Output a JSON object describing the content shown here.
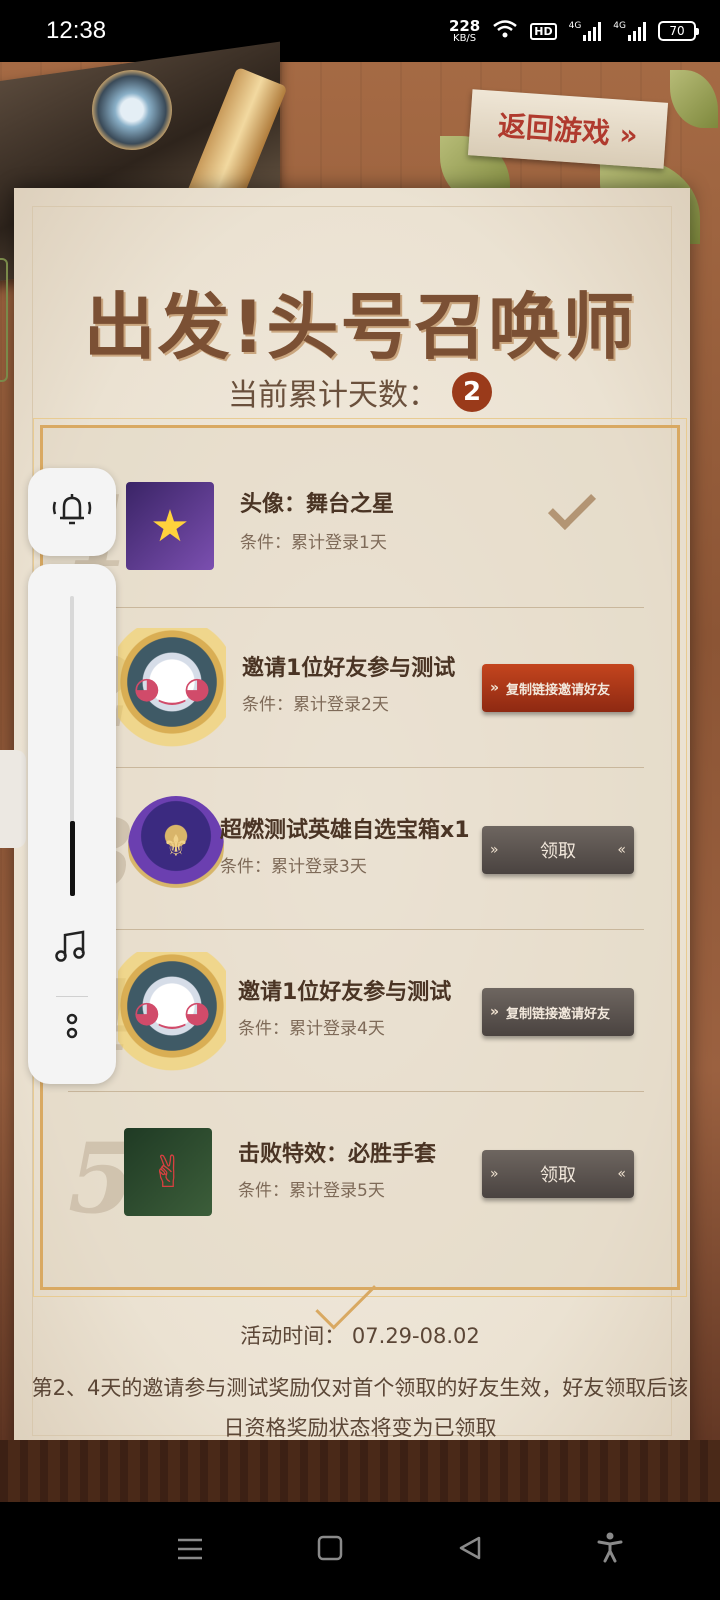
{
  "status_bar": {
    "time": "12:38",
    "net_speed_value": "228",
    "net_speed_unit": "KB/S",
    "wifi_icon": "wifi-icon",
    "hd_badge": "HD",
    "signal1_label": "4G",
    "signal2_label": "4G",
    "battery": "70"
  },
  "header": {
    "return_button": "返回游戏 »",
    "title": "出发!头号召唤师",
    "days_label": "当前累计天数：",
    "days_value": "2"
  },
  "rewards": [
    {
      "index": "1",
      "icon": "star-avatar-icon",
      "title": "头像：舞台之星",
      "condition": "条件：累计登录1天",
      "status": "claimed"
    },
    {
      "index": "2",
      "icon": "poro-icon",
      "title": "邀请1位好友参与测试",
      "condition": "条件：累计登录2天",
      "button": "复制链接邀请好友",
      "button_color": "#c4451e"
    },
    {
      "index": "3",
      "icon": "hero-chest-icon",
      "title": "超燃测试英雄自选宝箱x1",
      "condition": "条件：累计登录3天",
      "button": "领取",
      "button_color": "#5c5450"
    },
    {
      "index": "4",
      "icon": "poro-icon",
      "title": "邀请1位好友参与测试",
      "condition": "条件：累计登录4天",
      "button": "复制链接邀请好友",
      "button_color": "#5c5450"
    },
    {
      "index": "5",
      "icon": "victory-glove-icon",
      "title": "击败特效：必胜手套",
      "condition": "条件：累计登录5天",
      "button": "领取",
      "button_color": "#5c5450"
    }
  ],
  "footer": {
    "activity_time": "活动时间：  07.29-08.02",
    "note": "第2、4天的邀请参与测试奖励仅对首个领取的好友生效，好友领取后该日资格奖励状态将变为已领取"
  },
  "float_panel": {
    "bell_icon": "bell-icon",
    "volume_level": 0.25,
    "music_icon": "music-note-icon",
    "more_icon": "more-options-icon"
  },
  "nav_bar": {
    "menu_icon": "menu-icon",
    "home_icon": "home-icon",
    "back_icon": "back-icon",
    "accessibility_icon": "accessibility-icon"
  }
}
